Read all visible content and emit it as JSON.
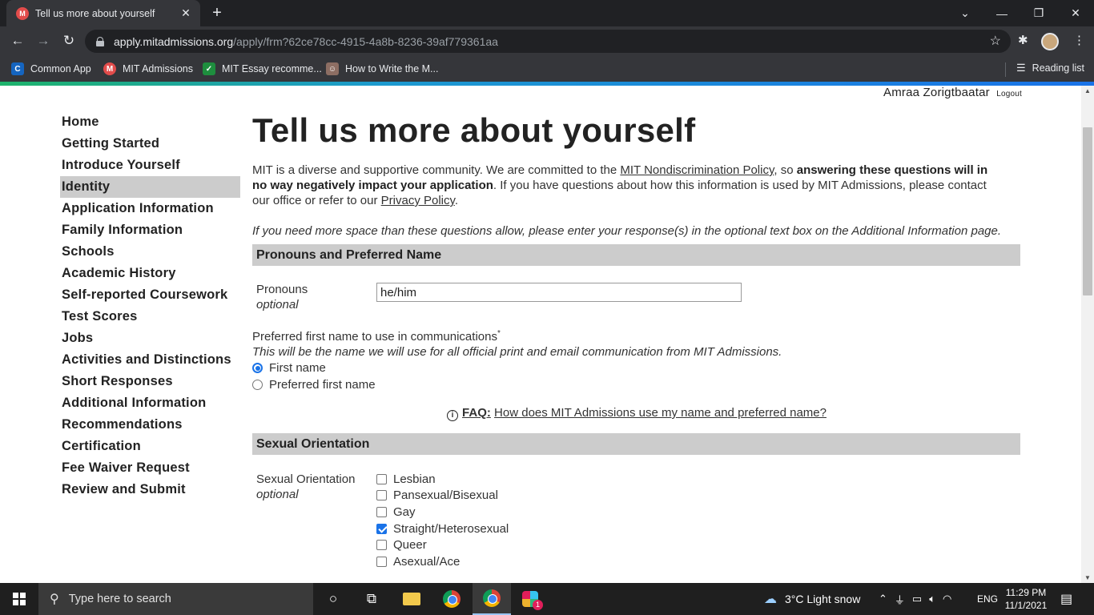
{
  "browser": {
    "tab_title": "Tell us more about yourself",
    "tab_favicon": "mit-favicon",
    "url_host": "apply.mitadmissions.org",
    "url_path": "/apply/frm?62ce78cc-4915-4a8b-8236-39af779361aa",
    "bookmarks": [
      {
        "label": "Common App",
        "icon": "commonapp-icon",
        "color": "#1565c0"
      },
      {
        "label": "MIT Admissions",
        "icon": "mit-icon",
        "color": "#e24c4b"
      },
      {
        "label": "MIT Essay recomme...",
        "icon": "check-icon",
        "color": "#1e8e3e"
      },
      {
        "label": "How to Write the M...",
        "icon": "avatar-icon",
        "color": "#8d6e63"
      }
    ],
    "reading_list": "Reading list"
  },
  "page": {
    "user_name": "Amraa Zorigtbaatar",
    "logout": "Logout",
    "nav": [
      "Home",
      "Getting Started",
      "Introduce Yourself",
      "Identity",
      "Application Information",
      "Family Information",
      "Schools",
      "Academic History",
      "Self-reported Coursework",
      "Test Scores",
      "Jobs",
      "Activities and Distinctions",
      "Short Responses",
      "Additional Information",
      "Recommendations",
      "Certification",
      "Fee Waiver Request",
      "Review and Submit"
    ],
    "active_nav": "Identity",
    "title": "Tell us more about yourself",
    "intro": {
      "part1": "MIT is a diverse and supportive community. We are committed to the ",
      "link1": "MIT Nondiscrimination Policy",
      "part2": ", so ",
      "bold": "answering these questions will in no way negatively impact your application",
      "part3": ". If you have questions about how this information is used by MIT Admissions, please contact our office or refer to our ",
      "link2": "Privacy Policy",
      "part4": "."
    },
    "note": "If you need more space than these questions allow, please enter your response(s) in the optional text box on the Additional Information page.",
    "section_pronouns": "Pronouns and Preferred Name",
    "pronouns_label": "Pronouns",
    "optional": "optional",
    "pronouns_value": "he/him",
    "preferred_label": "Preferred first name to use in communications",
    "required_mark": "*",
    "preferred_note": "This will be the name we will use for all official print and email communication from MIT Admissions.",
    "radio_options": [
      {
        "label": "First name",
        "checked": true
      },
      {
        "label": "Preferred first name",
        "checked": false
      }
    ],
    "faq_label": "FAQ:",
    "faq_text": "How does MIT Admissions use my name and preferred name?",
    "section_orientation": "Sexual Orientation",
    "orientation_label": "Sexual Orientation",
    "orientation_options": [
      {
        "label": "Lesbian",
        "checked": false
      },
      {
        "label": "Pansexual/Bisexual",
        "checked": false
      },
      {
        "label": "Gay",
        "checked": false
      },
      {
        "label": "Straight/Heterosexual",
        "checked": true
      },
      {
        "label": "Queer",
        "checked": false
      },
      {
        "label": "Asexual/Ace",
        "checked": false
      }
    ]
  },
  "taskbar": {
    "search_placeholder": "Type here to search",
    "weather": "3°C  Light snow",
    "language": "ENG",
    "time": "11:29 PM",
    "date": "11/1/2021",
    "slack_badge": "1"
  }
}
